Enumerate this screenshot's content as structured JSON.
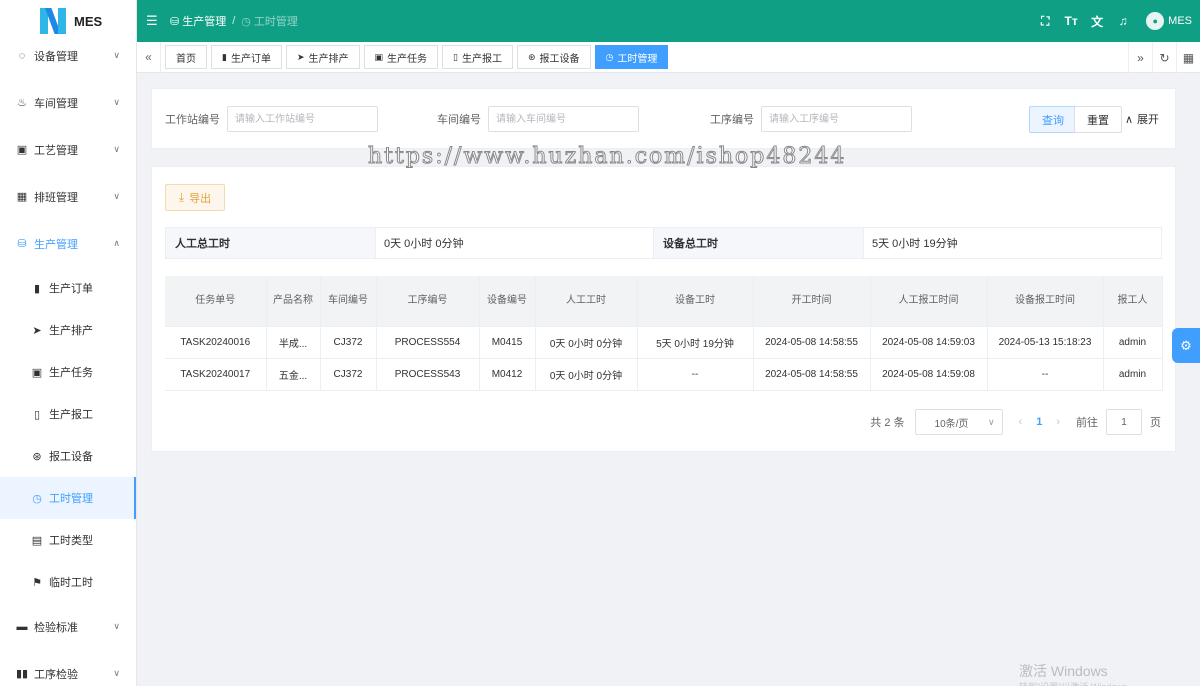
{
  "app": {
    "logo_text": "MES"
  },
  "topbar": {
    "breadcrumb": [
      "生产管理",
      "工时管理"
    ],
    "user": "MES",
    "icons": [
      "fullscreen-icon",
      "font-size-icon",
      "translate-icon",
      "bell-icon"
    ]
  },
  "sidebar": {
    "items": [
      {
        "label": "设备管理",
        "icon": "◌"
      },
      {
        "label": "车间管理",
        "icon": "♨"
      },
      {
        "label": "工艺管理",
        "icon": "▣"
      },
      {
        "label": "排班管理",
        "icon": "▦"
      },
      {
        "label": "生产管理",
        "icon": "⛁"
      }
    ],
    "sub_items": [
      {
        "label": "生产订单",
        "icon": "▮"
      },
      {
        "label": "生产排产",
        "icon": "➤"
      },
      {
        "label": "生产任务",
        "icon": "▣"
      },
      {
        "label": "生产报工",
        "icon": "▯"
      },
      {
        "label": "报工设备",
        "icon": "⊛"
      },
      {
        "label": "工时管理",
        "icon": "◷"
      },
      {
        "label": "工时类型",
        "icon": "▤"
      },
      {
        "label": "临时工时",
        "icon": "⚑"
      }
    ],
    "bottom_items": [
      {
        "label": "检验标准",
        "icon": "▬"
      },
      {
        "label": "工序检验",
        "icon": "▮▮"
      }
    ]
  },
  "tags": [
    {
      "label": "首页",
      "icon": ""
    },
    {
      "label": "生产订单",
      "icon": "▮"
    },
    {
      "label": "生产排产",
      "icon": "➤"
    },
    {
      "label": "生产任务",
      "icon": "▣"
    },
    {
      "label": "生产报工",
      "icon": "▯"
    },
    {
      "label": "报工设备",
      "icon": "⊛"
    },
    {
      "label": "工时管理",
      "icon": "◷"
    }
  ],
  "search": {
    "workstation_label": "工作站编号",
    "workstation_placeholder": "请输入工作站编号",
    "workshop_label": "车间编号",
    "workshop_placeholder": "请输入车间编号",
    "process_label": "工序编号",
    "process_placeholder": "请输入工序编号",
    "query_label": "查询",
    "reset_label": "重置",
    "expand_label": "展开"
  },
  "toolbar": {
    "export_label": "导出"
  },
  "summary": {
    "manual_label": "人工总工时",
    "manual_value": "0天 0小时 0分钟",
    "device_label": "设备总工时",
    "device_value": "5天 0小时 19分钟"
  },
  "table": {
    "columns": [
      "任务单号",
      "产品名称",
      "车间编号",
      "工序编号",
      "设备编号",
      "人工工时",
      "设备工时",
      "开工时间",
      "人工报工时间",
      "设备报工时间",
      "报工人"
    ],
    "rows": [
      [
        "TASK20240016",
        "半成...",
        "CJ372",
        "PROCESS554",
        "M0415",
        "0天 0小时 0分钟",
        "5天 0小时 19分钟",
        "2024-05-08 14:58:55",
        "2024-05-08 14:59:03",
        "2024-05-13 15:18:23",
        "admin"
      ],
      [
        "TASK20240017",
        "五金...",
        "CJ372",
        "PROCESS543",
        "M0412",
        "0天 0小时 0分钟",
        "--",
        "2024-05-08 14:58:55",
        "2024-05-08 14:59:08",
        "--",
        "admin"
      ]
    ]
  },
  "pagination": {
    "total": "共 2 条",
    "page_size": "10条/页",
    "current_page": "1",
    "goto_label": "前往",
    "goto_value": "1",
    "page_unit": "页"
  },
  "watermark": "https://www.huzhan.com/ishop48244",
  "windows_mark": "激活 Windows",
  "windows_sub": "转到\"设置\"以激活 Windows。",
  "colors": {
    "header": "#0e9f85",
    "primary": "#409eff",
    "warning": "#e6a23c"
  }
}
